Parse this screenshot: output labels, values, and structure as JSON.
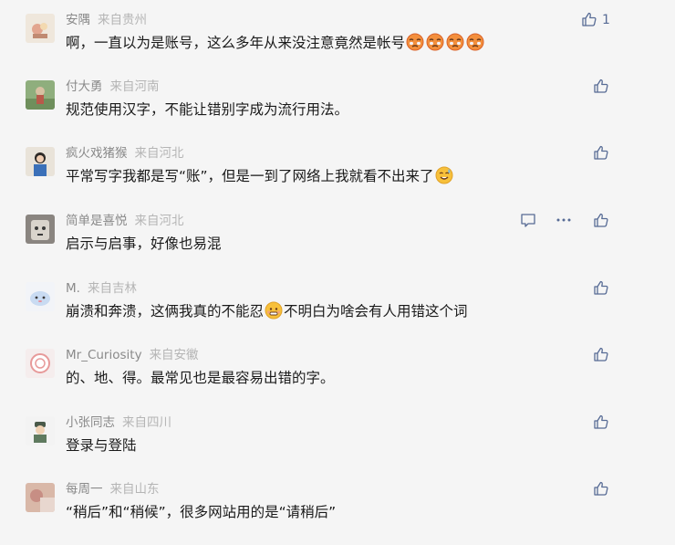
{
  "comments": [
    {
      "nickname": "安隅",
      "location": "来自贵州",
      "text": "啊，一直以为是账号，这么多年从来没注意竟然是帐号",
      "likes": "1",
      "emoji_count": 4,
      "emoji": "bleeding-cry-face"
    },
    {
      "nickname": "付大勇",
      "location": "来自河南",
      "text": "规范使用汉字，不能让错别字成为流行用法。",
      "likes": ""
    },
    {
      "nickname": "疯火戏猪猴",
      "location": "来自河北",
      "text": "平常写字我都是写“账”，但是一到了网络上我就看不出来了",
      "likes": "",
      "emoji": "sweat-smile-face"
    },
    {
      "nickname": "简单是喜悦",
      "location": "来自河北",
      "text": "启示与启事，好像也易混",
      "likes": "",
      "hovered": true
    },
    {
      "nickname": "M.",
      "location": "来自吉林",
      "text_before": "崩溃和奔溃，这俩我真的不能忍",
      "text_after": "不明白为啥会有人用错这个词",
      "likes": "",
      "emoji": "awkward-face"
    },
    {
      "nickname": "Mr_Curiosity",
      "location": "来自安徽",
      "text": "的、地、得。最常见也是最容易出错的字。",
      "likes": ""
    },
    {
      "nickname": "小张同志",
      "location": "来自四川",
      "text": "登录与登陆",
      "likes": ""
    },
    {
      "nickname": "每周一",
      "location": "来自山东",
      "text": "“稍后”和“稍候”，很多网站用的是“请稍后”",
      "likes": ""
    }
  ],
  "colors": {
    "background": "#f5f5f5",
    "nickname": "#8a8a8a",
    "location": "#b5b5b5",
    "text": "#1a1a1a",
    "icon": "#576b95",
    "emoji_yellow": "#f7c03a",
    "emoji_red": "#e8433d"
  }
}
